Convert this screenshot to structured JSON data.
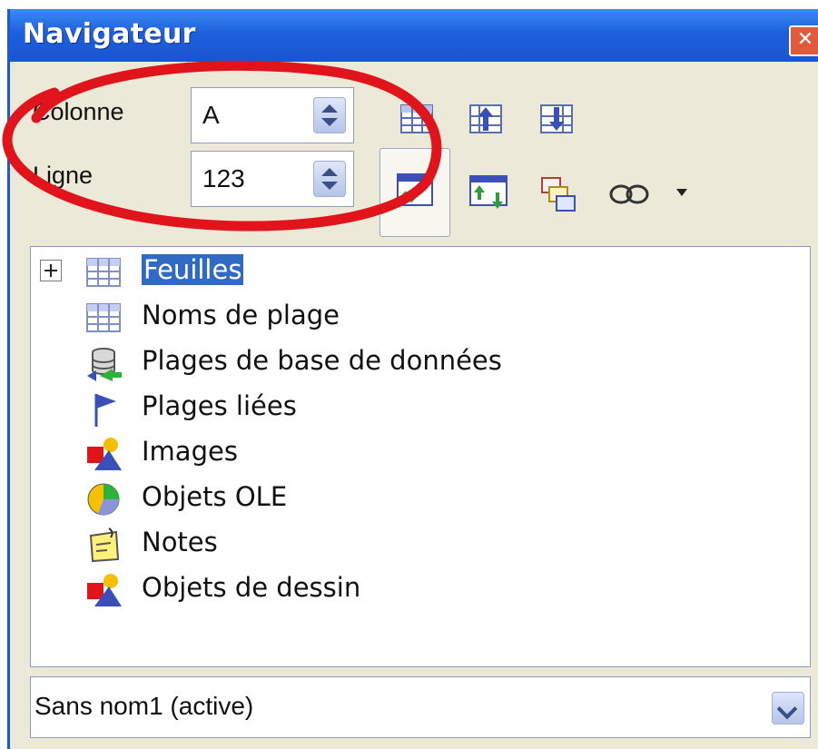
{
  "window": {
    "title": "Navigateur",
    "close_glyph": "✕"
  },
  "navigation": {
    "column_label": "Colonne",
    "column_value": "A",
    "row_label": "Ligne",
    "row_value": "123"
  },
  "toolbar": {
    "buttons": [
      "data-range-icon",
      "start-icon",
      "end-icon",
      "toggle-content-icon",
      "scenarios-icon",
      "drag-mode-icon",
      "linked-documents-icon"
    ]
  },
  "tree": {
    "items": [
      {
        "label": "Feuilles",
        "icon": "sheet-icon",
        "expandable": true,
        "selected": true
      },
      {
        "label": "Noms de plage",
        "icon": "range-names-icon"
      },
      {
        "label": "Plages de base de données",
        "icon": "database-range-icon"
      },
      {
        "label": "Plages liées",
        "icon": "linked-range-flag-icon"
      },
      {
        "label": "Images",
        "icon": "images-icon"
      },
      {
        "label": "Objets OLE",
        "icon": "ole-objects-icon"
      },
      {
        "label": "Notes",
        "icon": "notes-icon"
      },
      {
        "label": "Objets de dessin",
        "icon": "drawing-objects-icon"
      }
    ]
  },
  "document_selector": {
    "value": "Sans nom1 (active)"
  },
  "colors": {
    "titlebar": "#1e5fdd",
    "selection": "#316ac5",
    "annotation": "#e0141a",
    "panel": "#ece9d8"
  }
}
